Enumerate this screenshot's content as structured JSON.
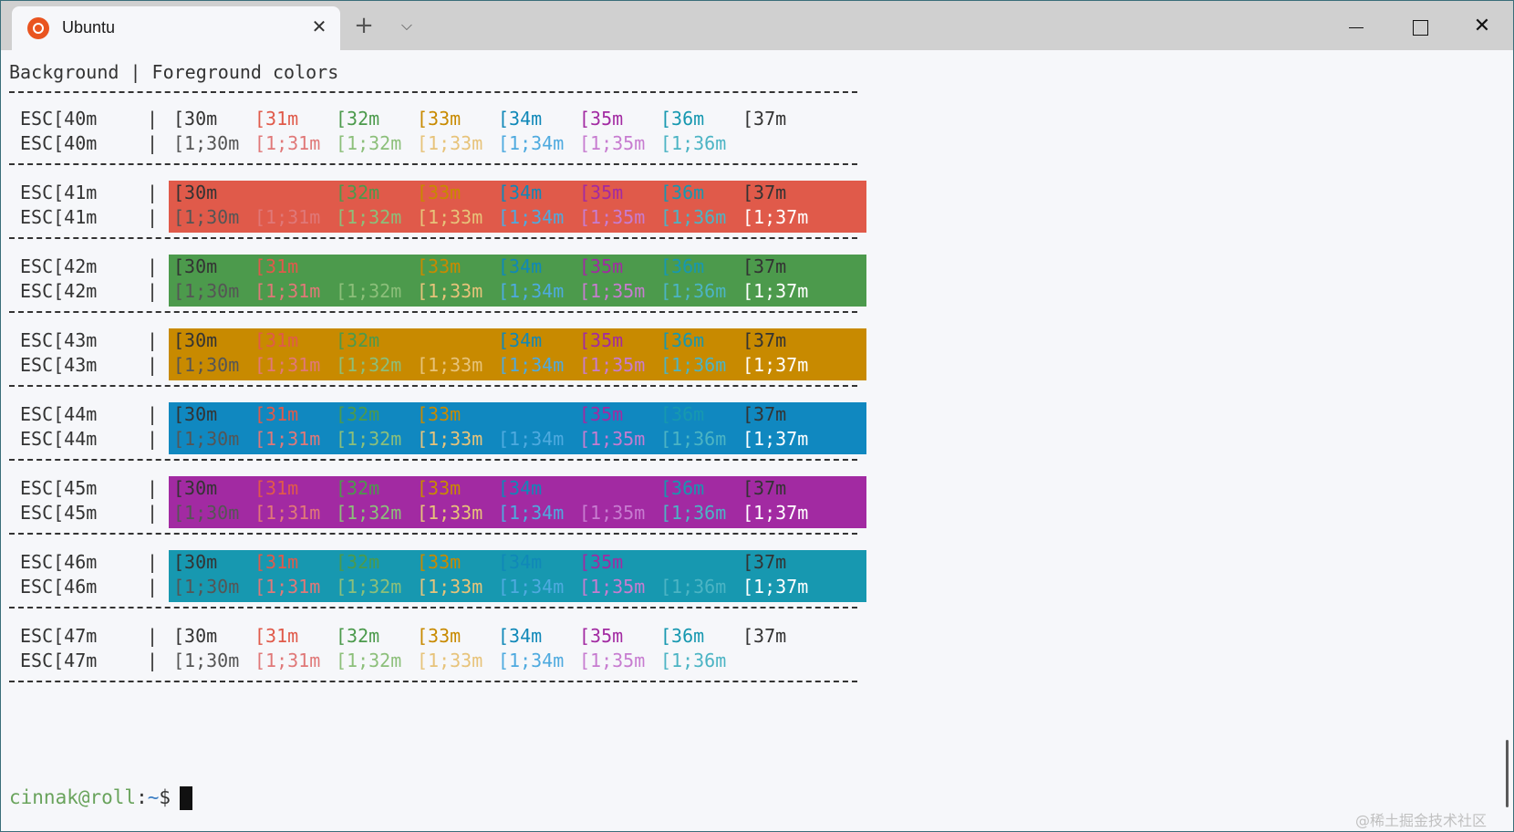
{
  "window": {
    "tab_title": "Ubuntu",
    "tab_icon": "ubuntu-logo-icon",
    "new_tab_icon": "plus-icon",
    "dropdown_icon": "chevron-down-icon",
    "minimize_icon": "minimize-icon",
    "maximize_icon": "maximize-icon",
    "close_icon": "close-icon"
  },
  "terminal": {
    "header": "Background | Foreground colors",
    "pipe": "|",
    "palette": {
      "30": "#333333",
      "31": "#e05a4a",
      "32": "#4c9a4c",
      "33": "#c88a00",
      "34": "#1088b8",
      "35": "#a22aa2",
      "36": "#1798b0",
      "37": "#333333",
      "1;30": "#555555",
      "1;31": "#e07878",
      "1;32": "#8cbf7a",
      "1;33": "#e7c37a",
      "1;34": "#4eaadf",
      "1;35": "#c77cd0",
      "1;36": "#4cb4c4",
      "1;37": "#ffffff"
    },
    "rows": [
      {
        "bg_code": "40m",
        "bg_color": "",
        "line1_label": "ESC[40m",
        "line2_label": "ESC[40m",
        "line1": [
          "[30m",
          "[31m",
          "[32m",
          "[33m",
          "[34m",
          "[35m",
          "[36m",
          "[37m"
        ],
        "line2": [
          "[1;30m",
          "[1;31m",
          "[1;32m",
          "[1;33m",
          "[1;34m",
          "[1;35m",
          "[1;36m",
          ""
        ]
      },
      {
        "bg_code": "41m",
        "bg_color": "#e05a4a",
        "line1_label": "ESC[41m",
        "line2_label": "ESC[41m",
        "line1": [
          "[30m",
          "",
          "[32m",
          "[33m",
          "[34m",
          "[35m",
          "[36m",
          "[37m"
        ],
        "line2": [
          "[1;30m",
          "[1;31m",
          "[1;32m",
          "[1;33m",
          "[1;34m",
          "[1;35m",
          "[1;36m",
          "[1;37m"
        ]
      },
      {
        "bg_code": "42m",
        "bg_color": "#4c9a4c",
        "line1_label": "ESC[42m",
        "line2_label": "ESC[42m",
        "line1": [
          "[30m",
          "[31m",
          "",
          "[33m",
          "[34m",
          "[35m",
          "[36m",
          "[37m"
        ],
        "line2": [
          "[1;30m",
          "[1;31m",
          "[1;32m",
          "[1;33m",
          "[1;34m",
          "[1;35m",
          "[1;36m",
          "[1;37m"
        ]
      },
      {
        "bg_code": "43m",
        "bg_color": "#c88a00",
        "line1_label": "ESC[43m",
        "line2_label": "ESC[43m",
        "line1": [
          "[30m",
          "[31m",
          "[32m",
          "",
          "[34m",
          "[35m",
          "[36m",
          "[37m"
        ],
        "line2": [
          "[1;30m",
          "[1;31m",
          "[1;32m",
          "[1;33m",
          "[1;34m",
          "[1;35m",
          "[1;36m",
          "[1;37m"
        ]
      },
      {
        "bg_code": "44m",
        "bg_color": "#1088c0",
        "line1_label": "ESC[44m",
        "line2_label": "ESC[44m",
        "line1": [
          "[30m",
          "[31m",
          "[32m",
          "[33m",
          "",
          "[35m",
          "[36m",
          "[37m"
        ],
        "line2": [
          "[1;30m",
          "[1;31m",
          "[1;32m",
          "[1;33m",
          "[1;34m",
          "[1;35m",
          "[1;36m",
          "[1;37m"
        ]
      },
      {
        "bg_code": "45m",
        "bg_color": "#a22aa2",
        "line1_label": "ESC[45m",
        "line2_label": "ESC[45m",
        "line1": [
          "[30m",
          "[31m",
          "[32m",
          "[33m",
          "[34m",
          "",
          "[36m",
          "[37m"
        ],
        "line2": [
          "[1;30m",
          "[1;31m",
          "[1;32m",
          "[1;33m",
          "[1;34m",
          "[1;35m",
          "[1;36m",
          "[1;37m"
        ]
      },
      {
        "bg_code": "46m",
        "bg_color": "#1798b0",
        "line1_label": "ESC[46m",
        "line2_label": "ESC[46m",
        "line1": [
          "[30m",
          "[31m",
          "[32m",
          "[33m",
          "[34m",
          "[35m",
          "",
          "[37m"
        ],
        "line2": [
          "[1;30m",
          "[1;31m",
          "[1;32m",
          "[1;33m",
          "[1;34m",
          "[1;35m",
          "[1;36m",
          "[1;37m"
        ]
      },
      {
        "bg_code": "47m",
        "bg_color": "",
        "line1_label": "ESC[47m",
        "line2_label": "ESC[47m",
        "line1": [
          "[30m",
          "[31m",
          "[32m",
          "[33m",
          "[34m",
          "[35m",
          "[36m",
          "[37m"
        ],
        "line2": [
          "[1;30m",
          "[1;31m",
          "[1;32m",
          "[1;33m",
          "[1;34m",
          "[1;35m",
          "[1;36m",
          ""
        ]
      }
    ],
    "prompt": {
      "user_host": "cinnak@roll",
      "colon": ":",
      "path": "~",
      "symbol": "$"
    }
  },
  "watermark": "@稀土掘金技术社区"
}
